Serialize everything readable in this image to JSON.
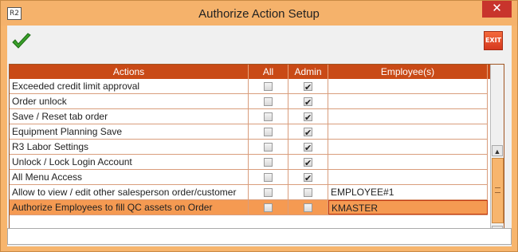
{
  "window": {
    "title": "Authorize Action Setup",
    "app_icon": "R2",
    "close_glyph": "✕"
  },
  "toolbar": {
    "ok_icon": "checkmark-icon",
    "exit_label": "EXIT"
  },
  "grid": {
    "columns": [
      "Actions",
      "All",
      "Admin",
      "Employee(s)"
    ],
    "rows": [
      {
        "action": "Exceeded credit limit approval",
        "all": false,
        "admin": true,
        "employees": ""
      },
      {
        "action": "Order unlock",
        "all": false,
        "admin": true,
        "employees": ""
      },
      {
        "action": "Save / Reset tab order",
        "all": false,
        "admin": true,
        "employees": ""
      },
      {
        "action": "Equipment Planning Save",
        "all": false,
        "admin": true,
        "employees": ""
      },
      {
        "action": "R3 Labor Settings",
        "all": false,
        "admin": true,
        "employees": ""
      },
      {
        "action": "Unlock / Lock Login Account",
        "all": false,
        "admin": true,
        "employees": ""
      },
      {
        "action": "All Menu Access",
        "all": false,
        "admin": true,
        "employees": ""
      },
      {
        "action": "Allow to view / edit other salesperson order/customer",
        "all": false,
        "admin": false,
        "employees": "EMPLOYEE#1"
      },
      {
        "action": "Authorize Employees to fill QC assets on Order",
        "all": false,
        "admin": false,
        "employees": "KMASTER",
        "selected": true
      }
    ]
  },
  "colors": {
    "header_bg": "#c94a16",
    "selected_row": "#f59a52",
    "frame": "#f7b56d"
  }
}
